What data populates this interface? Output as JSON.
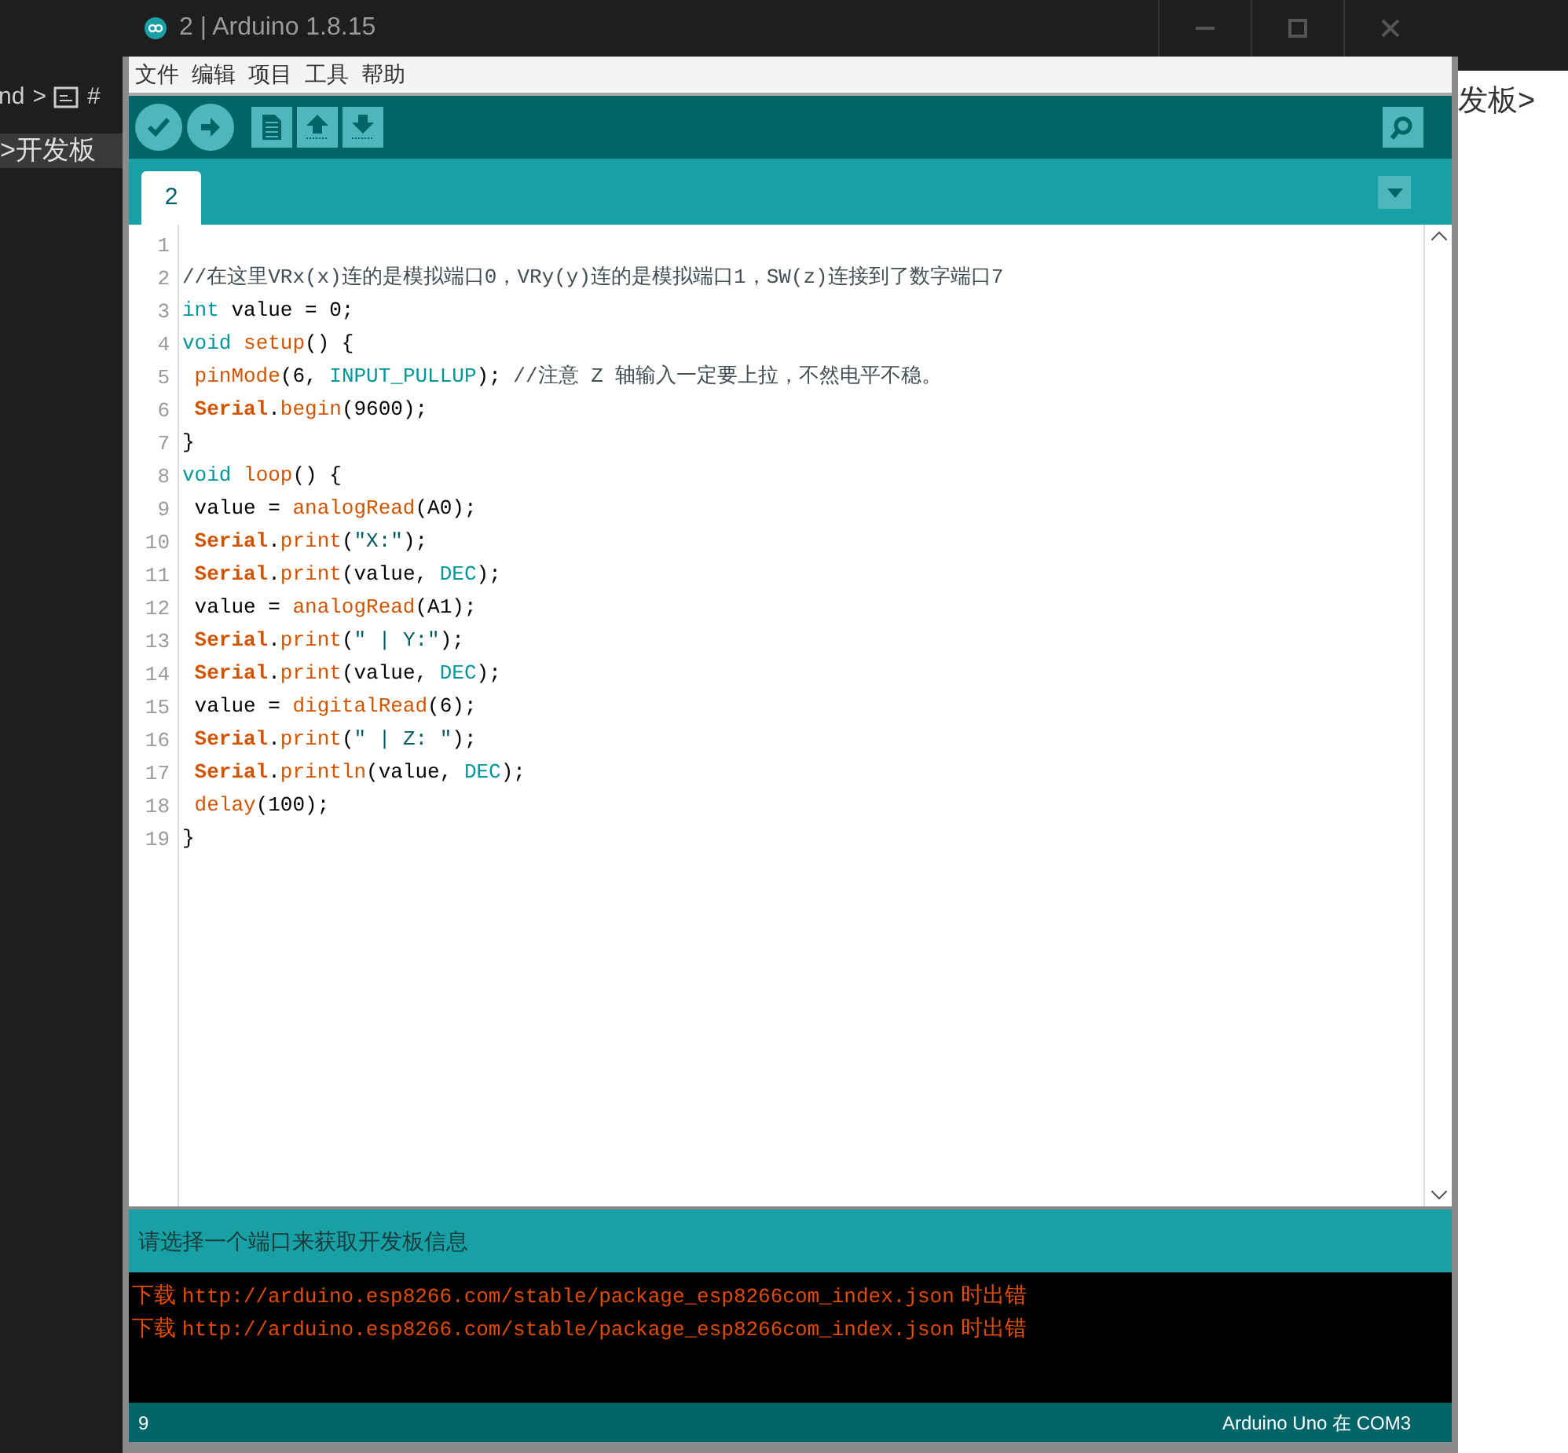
{
  "background": {
    "left_texts": [
      "nd",
      ">",
      "#",
      ">开发板"
    ],
    "right_texts": [
      "发板>"
    ]
  },
  "window": {
    "title": "2 | Arduino 1.8.15"
  },
  "menu": [
    "文件",
    "编辑",
    "项目",
    "工具",
    "帮助"
  ],
  "toolbar": [
    {
      "kind": "verify"
    },
    {
      "kind": "upload"
    },
    {
      "kind": "new"
    },
    {
      "kind": "open"
    },
    {
      "kind": "save"
    }
  ],
  "tabs": [
    {
      "label": "2",
      "selected": true
    }
  ],
  "editor": {
    "lines": [
      {
        "number": "1"
      },
      {
        "number": "2",
        "tokens": [
          {
            "kind": "comment",
            "text": "//在这里VRx(x)连的是模拟端口0，VRy(y)连的是模拟端口1，SW(z)连接到了数字端口7"
          }
        ]
      },
      {
        "number": "3",
        "tokens": [
          {
            "kind": "keyword",
            "text": "int"
          },
          {
            "kind": "plain",
            "text": " value = 0;"
          }
        ]
      },
      {
        "number": "4",
        "tokens": [
          {
            "kind": "keyword",
            "text": "void "
          },
          {
            "kind": "func",
            "text": "setup"
          },
          {
            "kind": "plain",
            "text": "() {"
          }
        ]
      },
      {
        "number": "5",
        "tokens": [
          {
            "kind": "func",
            "text": " pinMode"
          },
          {
            "kind": "plain",
            "text": "(6, "
          },
          {
            "kind": "const",
            "text": "INPUT_PULLUP"
          },
          {
            "kind": "plain",
            "text": "); "
          },
          {
            "kind": "comment",
            "text": "//注意 Z 轴输入一定要上拉，不然电平不稳。"
          }
        ]
      },
      {
        "number": "6",
        "tokens": [
          {
            "kind": "class",
            "text": " Serial"
          },
          {
            "kind": "plain",
            "text": "."
          },
          {
            "kind": "func",
            "text": "begin"
          },
          {
            "kind": "plain",
            "text": "(9600);"
          }
        ]
      },
      {
        "number": "7",
        "tokens": [
          {
            "kind": "plain",
            "text": "}"
          }
        ]
      },
      {
        "number": "8",
        "tokens": [
          {
            "kind": "keyword",
            "text": "void "
          },
          {
            "kind": "func",
            "text": "loop"
          },
          {
            "kind": "plain",
            "text": "() {"
          }
        ]
      },
      {
        "number": "9",
        "tokens": [
          {
            "kind": "plain",
            "text": " value = "
          },
          {
            "kind": "func",
            "text": "analogRead"
          },
          {
            "kind": "plain",
            "text": "(A0);"
          }
        ]
      },
      {
        "number": "10",
        "tokens": [
          {
            "kind": "class",
            "text": " Serial"
          },
          {
            "kind": "plain",
            "text": "."
          },
          {
            "kind": "func",
            "text": "print"
          },
          {
            "kind": "plain",
            "text": "("
          },
          {
            "kind": "string",
            "text": "\"X:\""
          },
          {
            "kind": "plain",
            "text": ");"
          }
        ]
      },
      {
        "number": "11",
        "tokens": [
          {
            "kind": "class",
            "text": " Serial"
          },
          {
            "kind": "plain",
            "text": "."
          },
          {
            "kind": "func",
            "text": "print"
          },
          {
            "kind": "plain",
            "text": "(value, "
          },
          {
            "kind": "const",
            "text": "DEC"
          },
          {
            "kind": "plain",
            "text": ");"
          }
        ]
      },
      {
        "number": "12",
        "tokens": [
          {
            "kind": "plain",
            "text": " value = "
          },
          {
            "kind": "func",
            "text": "analogRead"
          },
          {
            "kind": "plain",
            "text": "(A1);"
          }
        ]
      },
      {
        "number": "13",
        "tokens": [
          {
            "kind": "class",
            "text": " Serial"
          },
          {
            "kind": "plain",
            "text": "."
          },
          {
            "kind": "func",
            "text": "print"
          },
          {
            "kind": "plain",
            "text": "("
          },
          {
            "kind": "string",
            "text": "\" | Y:\""
          },
          {
            "kind": "plain",
            "text": ");"
          }
        ]
      },
      {
        "number": "14",
        "tokens": [
          {
            "kind": "class",
            "text": " Serial"
          },
          {
            "kind": "plain",
            "text": "."
          },
          {
            "kind": "func",
            "text": "print"
          },
          {
            "kind": "plain",
            "text": "(value, "
          },
          {
            "kind": "const",
            "text": "DEC"
          },
          {
            "kind": "plain",
            "text": ");"
          }
        ]
      },
      {
        "number": "15",
        "tokens": [
          {
            "kind": "plain",
            "text": " value = "
          },
          {
            "kind": "func",
            "text": "digitalRead"
          },
          {
            "kind": "plain",
            "text": "(6);"
          }
        ]
      },
      {
        "number": "16",
        "tokens": [
          {
            "kind": "class",
            "text": " Serial"
          },
          {
            "kind": "plain",
            "text": "."
          },
          {
            "kind": "func",
            "text": "print"
          },
          {
            "kind": "plain",
            "text": "("
          },
          {
            "kind": "string",
            "text": "\" | Z: \""
          },
          {
            "kind": "plain",
            "text": ");"
          }
        ]
      },
      {
        "number": "17",
        "tokens": [
          {
            "kind": "class",
            "text": " Serial"
          },
          {
            "kind": "plain",
            "text": "."
          },
          {
            "kind": "func",
            "text": "println"
          },
          {
            "kind": "plain",
            "text": "(value, "
          },
          {
            "kind": "const",
            "text": "DEC"
          },
          {
            "kind": "plain",
            "text": ");"
          }
        ]
      },
      {
        "number": "18",
        "tokens": [
          {
            "kind": "func",
            "text": " delay"
          },
          {
            "kind": "plain",
            "text": "(100);"
          }
        ]
      },
      {
        "number": "19",
        "tokens": [
          {
            "kind": "plain",
            "text": "}"
          }
        ]
      }
    ]
  },
  "message": "请选择一个端口来获取开发板信息",
  "console": [
    {
      "prefix": "下载",
      "url": "http://arduino.esp8266.com/stable/package_esp8266com_index.json",
      "suffix": "时出错"
    },
    {
      "prefix": "下载",
      "url": "http://arduino.esp8266.com/stable/package_esp8266com_index.json",
      "suffix": "时出错"
    }
  ],
  "status_bar": {
    "line": "9",
    "board": "Arduino Uno 在 COM3"
  }
}
